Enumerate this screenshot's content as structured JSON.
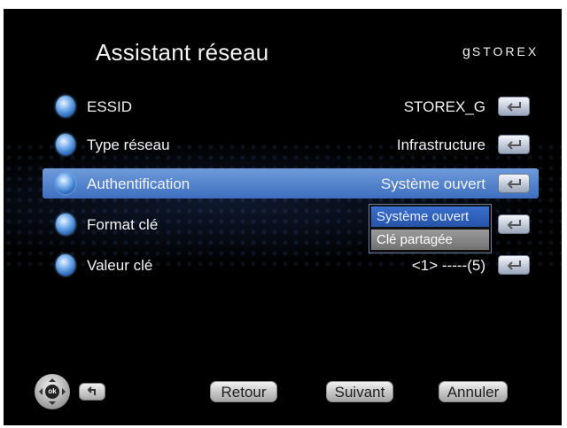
{
  "header": {
    "title": "Assistant réseau",
    "brand": "STOREX"
  },
  "rows": [
    {
      "label": "ESSID",
      "value": "STOREX_G"
    },
    {
      "label": "Type réseau",
      "value": "Infrastructure"
    },
    {
      "label": "Authentification",
      "value": "Système ouvert"
    },
    {
      "label": "Format clé",
      "value": ""
    },
    {
      "label": "Valeur clé",
      "value": "<1> -----(5)"
    }
  ],
  "dropdown": {
    "options": [
      "Système ouvert",
      "Clé partagée"
    ],
    "selected": "Système ouvert"
  },
  "footer": {
    "ok_label": "ok",
    "retour": "Retour",
    "suivant": "Suivant",
    "annuler": "Annuler"
  },
  "colors": {
    "selection": "#5b8ad4",
    "background": "#000000"
  },
  "icons": {
    "row": "globe-orb-icon",
    "enter": "enter-return-icon",
    "nav": "dpad-ok-icon",
    "back": "back-arrow-icon"
  }
}
